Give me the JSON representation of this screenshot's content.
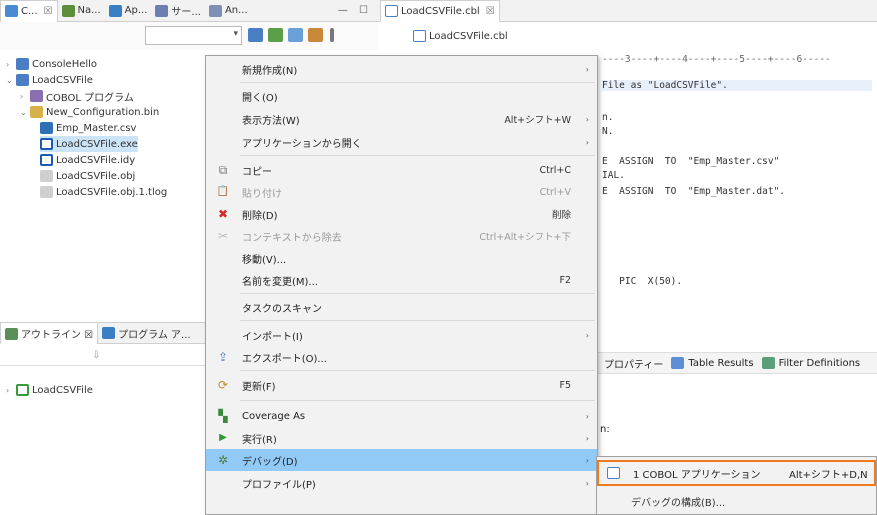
{
  "left_tabs": [
    {
      "label": "C...",
      "color": "#4a8ad4"
    },
    {
      "label": "Na...",
      "color": "#5b8f3a"
    },
    {
      "label": "Ap...",
      "color": "#3a7fc4"
    },
    {
      "label": "サー...",
      "color": "#6b7fb0"
    },
    {
      "label": "An...",
      "color": "#7f8fb5"
    }
  ],
  "window_controls": "— ☐",
  "editor_tab": {
    "label": "LoadCSVFile.cbl",
    "close": "☒"
  },
  "editor_breadcrumb": "LoadCSVFile.cbl",
  "tree": {
    "items": [
      {
        "label": "ConsoleHello",
        "arrow": "›",
        "color": "#4a7fc4"
      },
      {
        "label": "LoadCSVFile",
        "arrow": "⌄",
        "color": "#4a7fc4"
      },
      {
        "label": "COBOL プログラム",
        "arrow": "›",
        "color": "#8a6fb0"
      },
      {
        "label": "New_Configuration.bin",
        "arrow": "⌄",
        "color": "#d9b04a"
      },
      {
        "label": "Emp_Master.csv",
        "arrow": "",
        "color": "#2f6fb5"
      },
      {
        "label": "LoadCSVFile.exe",
        "arrow": "",
        "color": "#1e5bb5"
      },
      {
        "label": "LoadCSVFile.idy",
        "arrow": "",
        "color": "#1e5bb5"
      },
      {
        "label": "LoadCSVFile.obj",
        "arrow": "",
        "color": "#a0a0a0"
      },
      {
        "label": "LoadCSVFile.obj.1.tlog",
        "arrow": "",
        "color": "#a0a0a0"
      }
    ]
  },
  "outline": {
    "tab1": "アウトライン ☒",
    "tab2": "プログラム ア...",
    "item": "LoadCSVFile"
  },
  "editor_lines": [
    {
      "text": "----3----+----4----+----5----+----6-----"
    },
    {
      "text": "File as \"LoadCSVFile\"."
    },
    {
      "text": ""
    },
    {
      "text": "n."
    },
    {
      "text": "N."
    },
    {
      "text": ""
    },
    {
      "text": "E  ASSIGN  TO  \"Emp_Master.csv\""
    },
    {
      "text": "IAL."
    },
    {
      "text": "E  ASSIGN  TO  \"Emp_Master.dat\"."
    },
    {
      "text": ""
    },
    {
      "text": ""
    },
    {
      "text": ""
    },
    {
      "text": ""
    },
    {
      "text": ""
    },
    {
      "text": "   PIC  X(50)."
    }
  ],
  "props_bar": {
    "p1": "プロパティー",
    "p2": "Table Results",
    "p3": "Filter Definitions"
  },
  "n_label": "n:",
  "menu": {
    "items": [
      {
        "label": "新規作成(N)",
        "shortcut": "",
        "arrow": "›",
        "icon": "",
        "disabled": false
      },
      {
        "label": "開く(O)",
        "shortcut": "",
        "arrow": "",
        "icon": "",
        "disabled": false
      },
      {
        "label": "表示方法(W)",
        "shortcut": "Alt+シフト+W",
        "arrow": "›",
        "icon": "",
        "disabled": false
      },
      {
        "label": "アプリケーションから開く",
        "shortcut": "",
        "arrow": "›",
        "icon": "",
        "disabled": false
      },
      {
        "label": "コピー",
        "shortcut": "Ctrl+C",
        "arrow": "",
        "icon": "⧉",
        "disabled": false
      },
      {
        "label": "貼り付け",
        "shortcut": "Ctrl+V",
        "arrow": "",
        "icon": "📋",
        "disabled": true
      },
      {
        "label": "削除(D)",
        "shortcut": "削除",
        "arrow": "",
        "icon": "✖",
        "disabled": false
      },
      {
        "label": "コンテキストから除去",
        "shortcut": "Ctrl+Alt+シフト+下",
        "arrow": "",
        "icon": "✂",
        "disabled": true
      },
      {
        "label": "移動(V)...",
        "shortcut": "",
        "arrow": "",
        "icon": "",
        "disabled": false
      },
      {
        "label": "名前を変更(M)...",
        "shortcut": "F2",
        "arrow": "",
        "icon": "",
        "disabled": false
      },
      {
        "label": "タスクのスキャン",
        "shortcut": "",
        "arrow": "",
        "icon": "",
        "disabled": false
      },
      {
        "label": "インポート(I)",
        "shortcut": "",
        "arrow": "›",
        "icon": "",
        "disabled": false
      },
      {
        "label": "エクスポート(O)...",
        "shortcut": "",
        "arrow": "",
        "icon": "⇪",
        "disabled": false
      },
      {
        "label": "更新(F)",
        "shortcut": "F5",
        "arrow": "",
        "icon": "⟳",
        "disabled": false
      },
      {
        "label": "Coverage As",
        "shortcut": "",
        "arrow": "›",
        "icon": "▚",
        "disabled": false
      },
      {
        "label": "実行(R)",
        "shortcut": "",
        "arrow": "›",
        "icon": "▶",
        "disabled": false
      },
      {
        "label": "デバッグ(D)",
        "shortcut": "",
        "arrow": "›",
        "icon": "✲",
        "disabled": false
      },
      {
        "label": "プロファイル(P)",
        "shortcut": "",
        "arrow": "›",
        "icon": "",
        "disabled": false
      }
    ]
  },
  "submenu": {
    "item1_label": "1 COBOL アプリケーション",
    "item1_shortcut": "Alt+シフト+D,N",
    "item2_label": "デバッグの構成(B)..."
  }
}
